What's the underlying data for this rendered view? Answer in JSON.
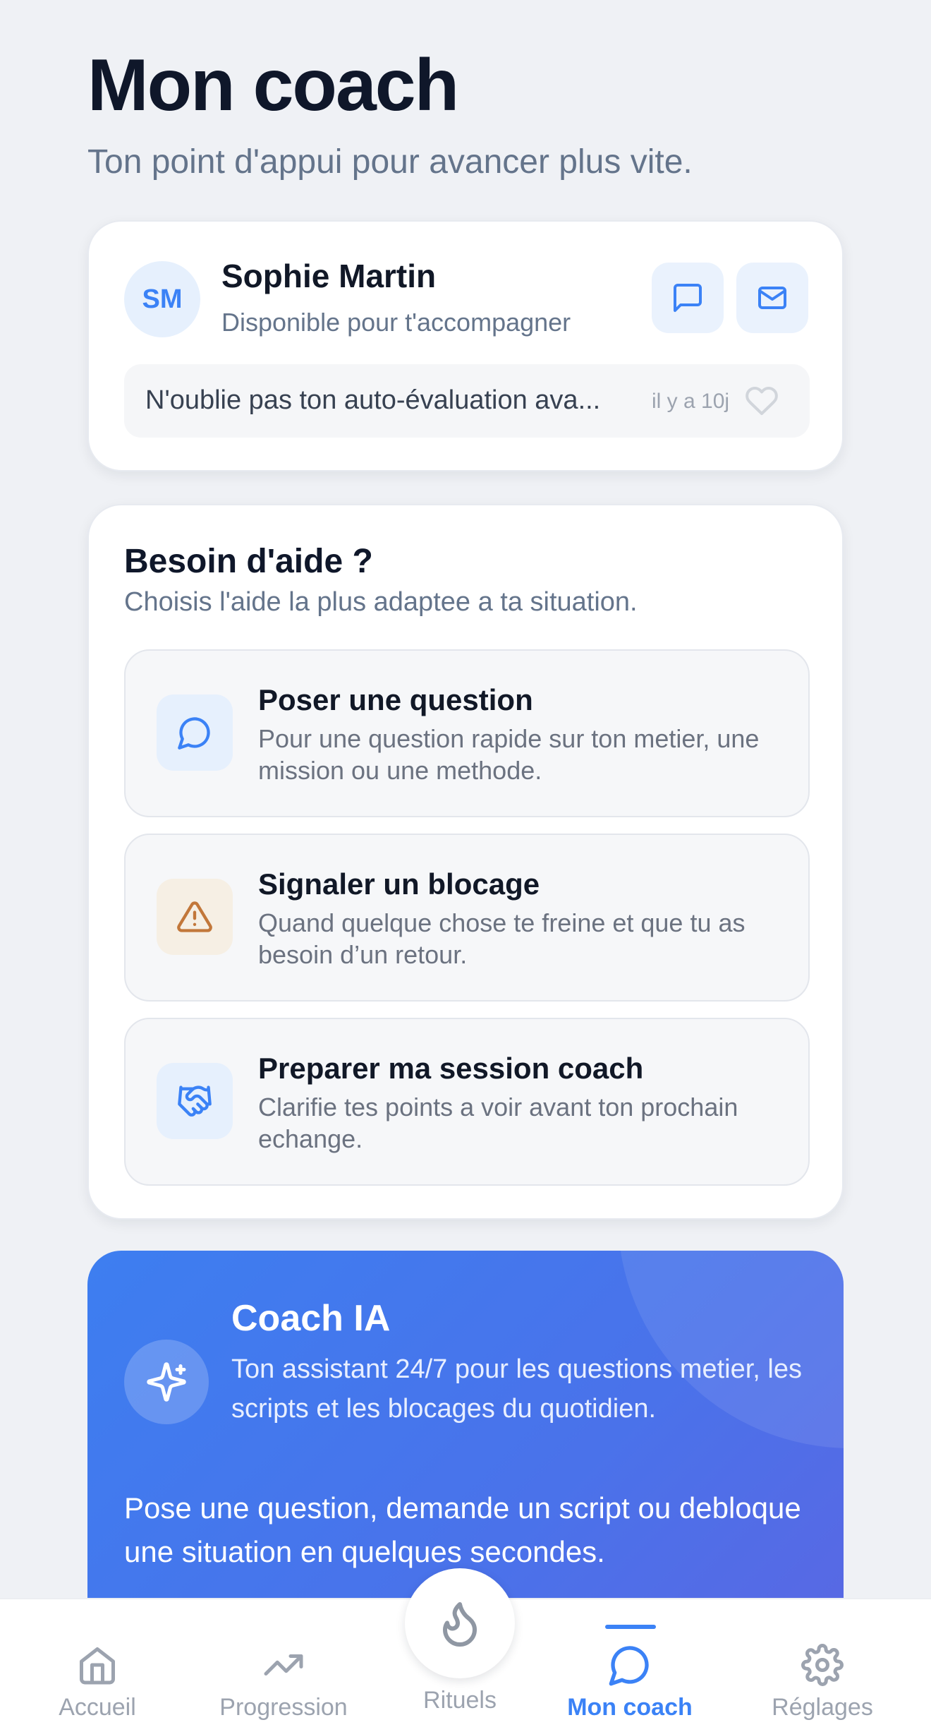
{
  "header": {
    "title": "Mon coach",
    "subtitle": "Ton point d'appui pour avancer plus vite."
  },
  "coach": {
    "initials": "SM",
    "name": "Sophie Martin",
    "status": "Disponible pour t'accompagner",
    "actions": {
      "chat_icon": "message-square-icon",
      "mail_icon": "mail-icon"
    },
    "last_message": {
      "text": "N'oublie pas ton auto-évaluation ava...",
      "time": "il y a 10j",
      "icon": "heart-icon"
    }
  },
  "help": {
    "title": "Besoin d'aide ?",
    "subtitle": "Choisis l'aide la plus adaptee a ta situation.",
    "items": [
      {
        "title": "Poser une question",
        "description": "Pour une question rapide sur ton metier, une mission ou une methode.",
        "icon": "message-circle-icon"
      },
      {
        "title": "Signaler un blocage",
        "description": "Quand quelque chose te freine et que tu as besoin d’un retour.",
        "icon": "alert-triangle-icon"
      },
      {
        "title": "Preparer ma session coach",
        "description": "Clarifie tes points a voir avant ton prochain echange.",
        "icon": "handshake-icon"
      }
    ]
  },
  "ai_coach": {
    "title": "Coach IA",
    "description": "Ton assistant 24/7 pour les questions metier, les scripts et les blocages du quotidien.",
    "body": "Pose une question, demande un script ou debloque une situation en quelques secondes.",
    "icon": "sparkles-icon"
  },
  "nav": {
    "items": [
      {
        "label": "Accueil",
        "icon": "home-icon"
      },
      {
        "label": "Progression",
        "icon": "trending-up-icon"
      },
      {
        "label": "Rituels",
        "icon": "flame-icon"
      },
      {
        "label": "Mon coach",
        "icon": "message-circle-icon",
        "active": true
      },
      {
        "label": "Réglages",
        "icon": "gear-icon"
      }
    ]
  },
  "colors": {
    "accent": "#3b82f6",
    "background": "#eff1f5",
    "warning": "#c2773a",
    "ai_gradient_start": "#3d7ef0",
    "ai_gradient_end": "#5a67e3"
  }
}
